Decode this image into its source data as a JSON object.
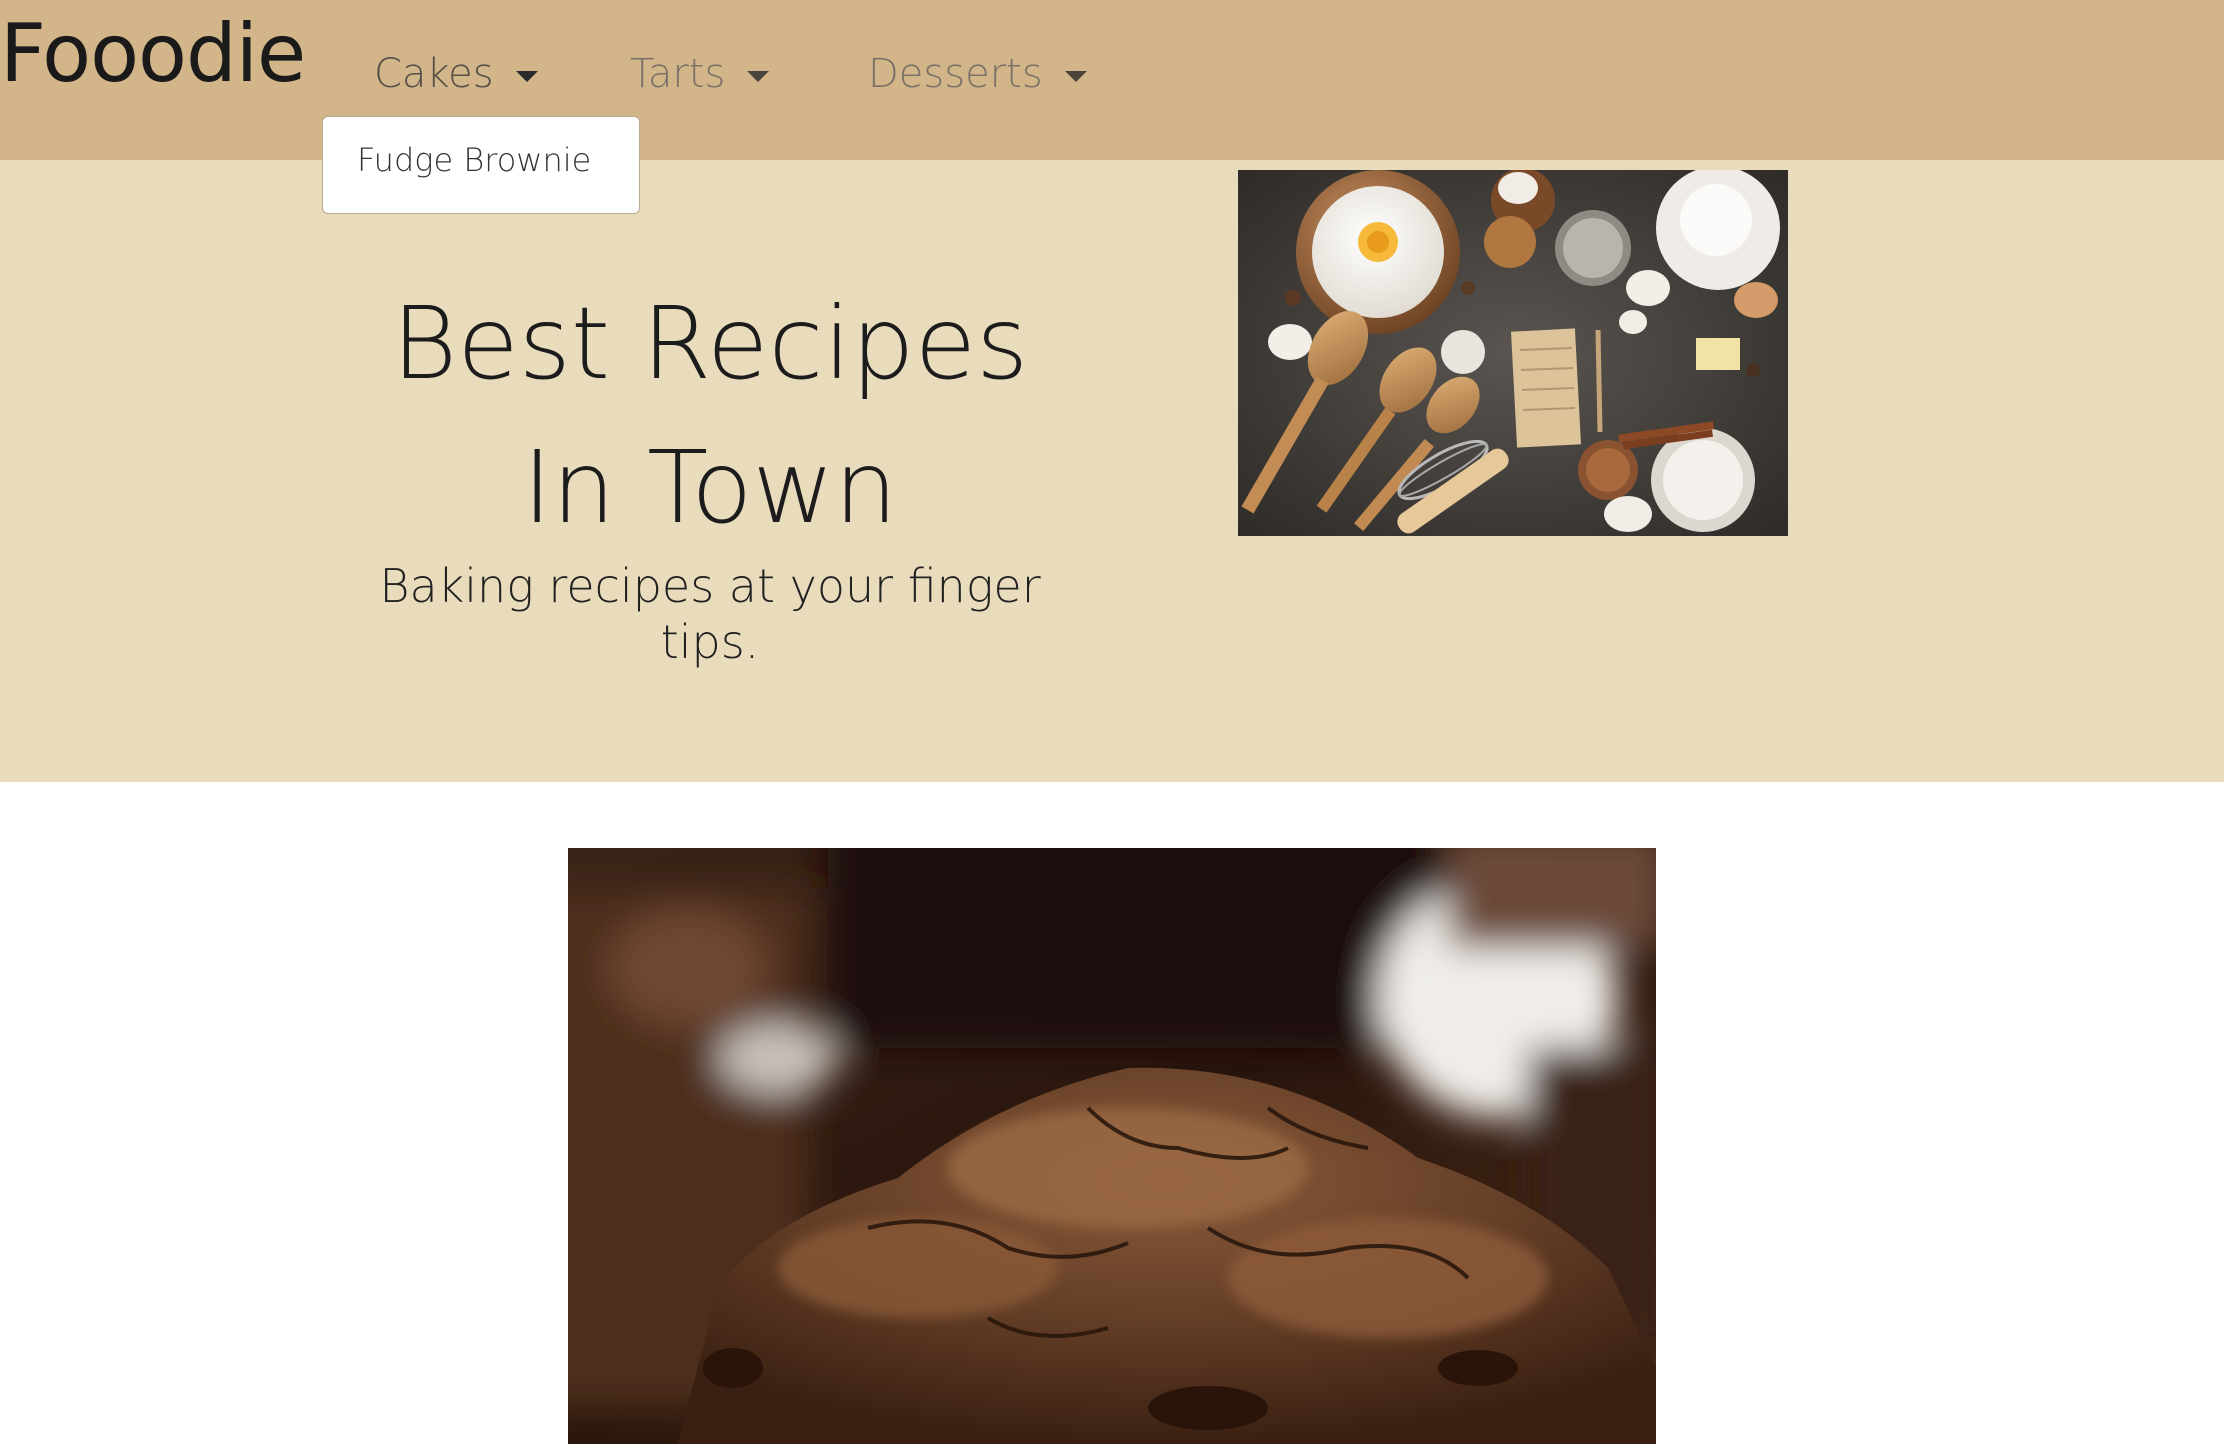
{
  "navbar": {
    "brand": "Fooodie",
    "items": [
      {
        "label": "Cakes"
      },
      {
        "label": "Tarts"
      },
      {
        "label": "Desserts"
      }
    ],
    "dropdown": {
      "items": [
        {
          "label": "Fudge Brownie"
        }
      ]
    }
  },
  "hero": {
    "title": "Best Recipes In Town",
    "subtitle": "Baking recipes at your finger tips.",
    "image_icon": "baking-ingredients-photo"
  },
  "main": {
    "image_icon": "fudge-brownie-photo"
  },
  "colors": {
    "navbar": "#d3b58a",
    "hero": "#e8dcbd",
    "page": "#ffffff"
  }
}
